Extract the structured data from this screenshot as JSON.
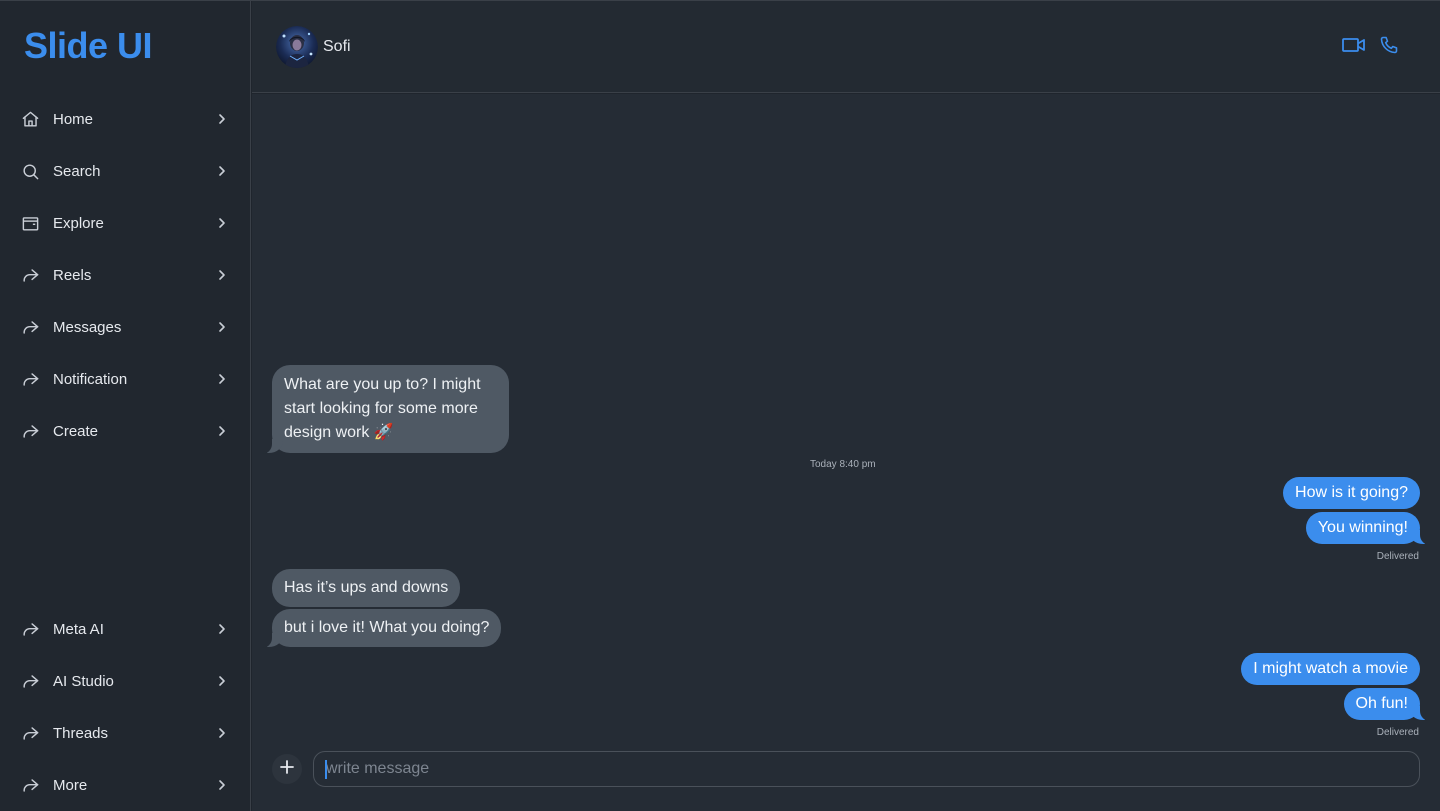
{
  "brand": {
    "title": "Slide UI"
  },
  "colors": {
    "accent": "#3b8ded",
    "incoming_bubble": "#4f5964",
    "background": "#252c35"
  },
  "sidebar": {
    "top_items": [
      {
        "label": "Home",
        "icon": "home-icon"
      },
      {
        "label": "Search",
        "icon": "search-icon"
      },
      {
        "label": "Explore",
        "icon": "wallet-icon"
      },
      {
        "label": "Reels",
        "icon": "share-arrow-icon"
      },
      {
        "label": "Messages",
        "icon": "share-arrow-icon"
      },
      {
        "label": "Notification",
        "icon": "share-arrow-icon"
      },
      {
        "label": "Create",
        "icon": "share-arrow-icon"
      }
    ],
    "bottom_items": [
      {
        "label": "Meta AI",
        "icon": "share-arrow-icon"
      },
      {
        "label": "AI Studio",
        "icon": "share-arrow-icon"
      },
      {
        "label": "Threads",
        "icon": "share-arrow-icon"
      },
      {
        "label": "More",
        "icon": "share-arrow-icon"
      }
    ]
  },
  "header": {
    "contact_name": "Sofi",
    "avatar_icon": "contact-avatar",
    "actions": {
      "video": "video-camera-icon",
      "phone": "phone-icon"
    }
  },
  "messages": [
    {
      "direction": "in",
      "text": "What are you up to? I might start looking for some more design work 🚀"
    },
    {
      "type": "timestamp",
      "text": "Today 8:40 pm"
    },
    {
      "direction": "out",
      "text": "How is it going?"
    },
    {
      "direction": "out",
      "text": "You winning!"
    },
    {
      "type": "status",
      "text": "Delivered"
    },
    {
      "direction": "in",
      "text": "Has it’s ups and downs"
    },
    {
      "direction": "in",
      "text": "but i love it! What you doing?"
    },
    {
      "direction": "out",
      "text": "I might watch a movie"
    },
    {
      "direction": "out",
      "text": "Oh fun!"
    },
    {
      "type": "status",
      "text": "Delivered"
    }
  ],
  "composer": {
    "placeholder": "write message",
    "value": "",
    "add_icon": "plus-icon"
  }
}
